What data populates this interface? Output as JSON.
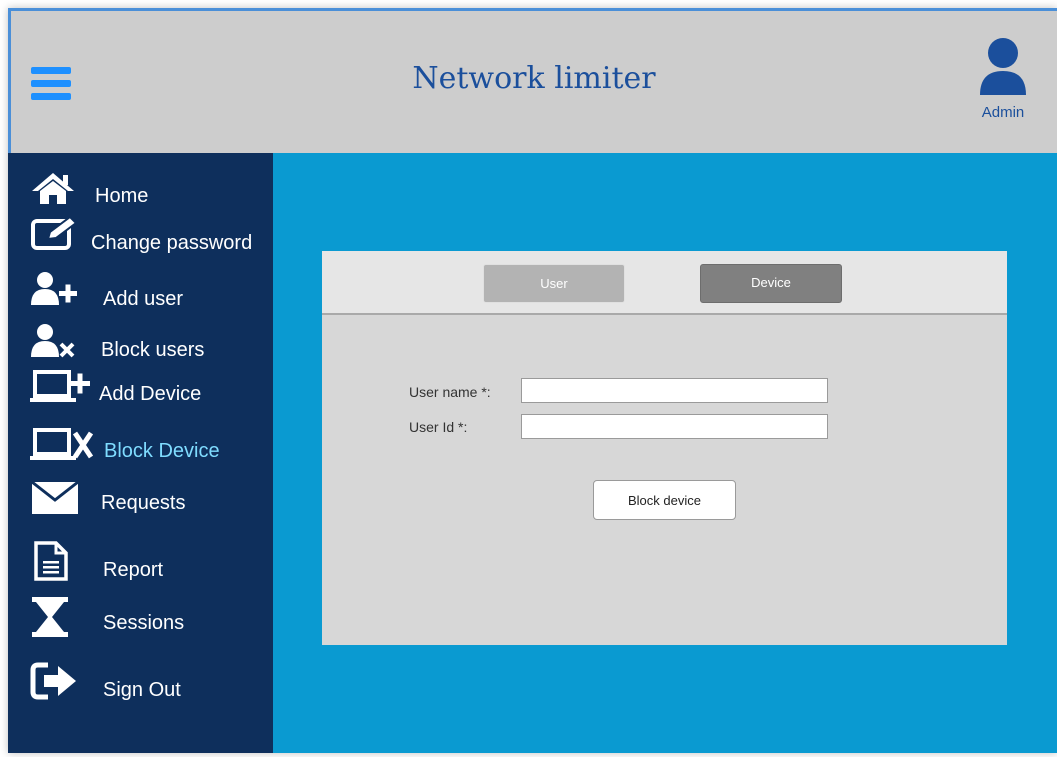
{
  "header": {
    "title": "Network limiter",
    "menu_icon": "hamburger-menu-icon",
    "user": {
      "icon": "user-avatar-icon",
      "label": "Admin"
    }
  },
  "sidebar": {
    "items": [
      {
        "label": "Home",
        "icon": "home-icon"
      },
      {
        "label": "Change password",
        "icon": "edit-icon"
      },
      {
        "label": "Add user",
        "icon": "add-user-icon"
      },
      {
        "label": "Block users",
        "icon": "block-user-icon"
      },
      {
        "label": "Add Device",
        "icon": "add-device-icon"
      },
      {
        "label": "Block Device",
        "icon": "block-device-icon",
        "active": true
      },
      {
        "label": "Requests",
        "icon": "envelope-icon"
      },
      {
        "label": "Report",
        "icon": "document-icon"
      },
      {
        "label": "Sessions",
        "icon": "hourglass-icon"
      },
      {
        "label": "Sign Out",
        "icon": "sign-out-icon"
      }
    ]
  },
  "panel": {
    "tabs": [
      {
        "label": "User",
        "active": false
      },
      {
        "label": "Device",
        "active": true
      }
    ],
    "form": {
      "user_name_label": "User name *:",
      "user_name_value": "",
      "user_id_label": "User Id *:",
      "user_id_value": "",
      "submit_label": "Block device"
    }
  },
  "colors": {
    "header_bg": "#cdcdcd",
    "title": "#1b4f9c",
    "accent": "#1e90ff",
    "sidebar_bg": "#0e2f5c",
    "sidebar_active": "#7fdcff",
    "content_bg": "#0a9ad1",
    "panel_bg": "#d7d7d7"
  }
}
